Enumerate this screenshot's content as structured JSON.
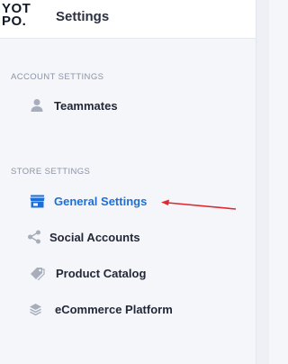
{
  "logo": {
    "line1": "YOT",
    "line2": "PO."
  },
  "header": {
    "title": "Settings"
  },
  "sections": {
    "account": {
      "label": "ACCOUNT SETTINGS"
    },
    "store": {
      "label": "STORE SETTINGS"
    }
  },
  "nav": {
    "teammates": {
      "label": "Teammates",
      "icon": "person-icon"
    },
    "general_settings": {
      "label": "General Settings",
      "icon": "store-icon",
      "active": true
    },
    "social_accounts": {
      "label": "Social Accounts",
      "icon": "share-icon"
    },
    "product_catalog": {
      "label": "Product Catalog",
      "icon": "tag-icon"
    },
    "ecommerce_platform": {
      "label": "eCommerce Platform",
      "icon": "layers-icon"
    }
  },
  "colors": {
    "accent": "#1c6fd9",
    "icon_gray": "#a7adbb",
    "annotation_arrow": "#e0282e"
  }
}
